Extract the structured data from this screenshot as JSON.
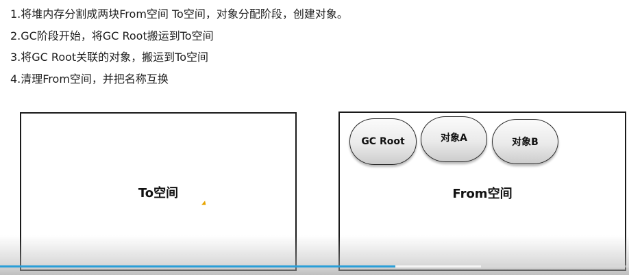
{
  "steps": [
    "1.将堆内存分割成两块From空间 To空间，对象分配阶段，创建对象。",
    "2.GC阶段开始，将GC Root搬运到To空间",
    "3.将GC Root关联的对象，搬运到To空间",
    "4.清理From空间，并把名称互换"
  ],
  "to_space": {
    "label": "To空间"
  },
  "from_space": {
    "label": "From空间",
    "nodes": [
      "GC Root",
      "对象A",
      "对象B"
    ]
  },
  "player": {
    "progress": 0.628,
    "buffered": 0.765,
    "accent_color": "#2a9fd8"
  }
}
